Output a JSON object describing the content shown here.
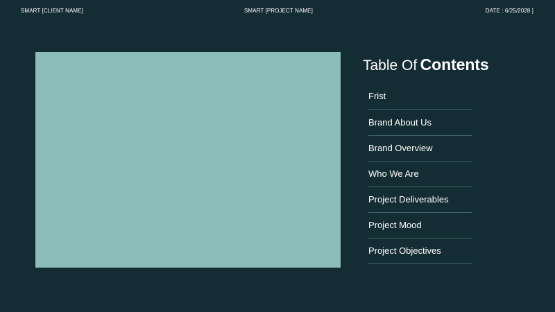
{
  "header": {
    "client": "SMART [CLIENT NAME]",
    "project": "SMART [PROJECT NAME]",
    "date": "DATE : 6/25/2028 ]"
  },
  "colors": {
    "background": "#142c33",
    "placeholder": "#8bbcba",
    "divider": "#3e6566",
    "text": "#ffffff"
  },
  "toc": {
    "title_light": "Table Of",
    "title_bold": "Contents",
    "items": [
      "Frist",
      "Brand About Us",
      "Brand Overview",
      "Who We Are",
      "Project Deliverables",
      "Project Mood",
      "Project Objectives"
    ]
  }
}
